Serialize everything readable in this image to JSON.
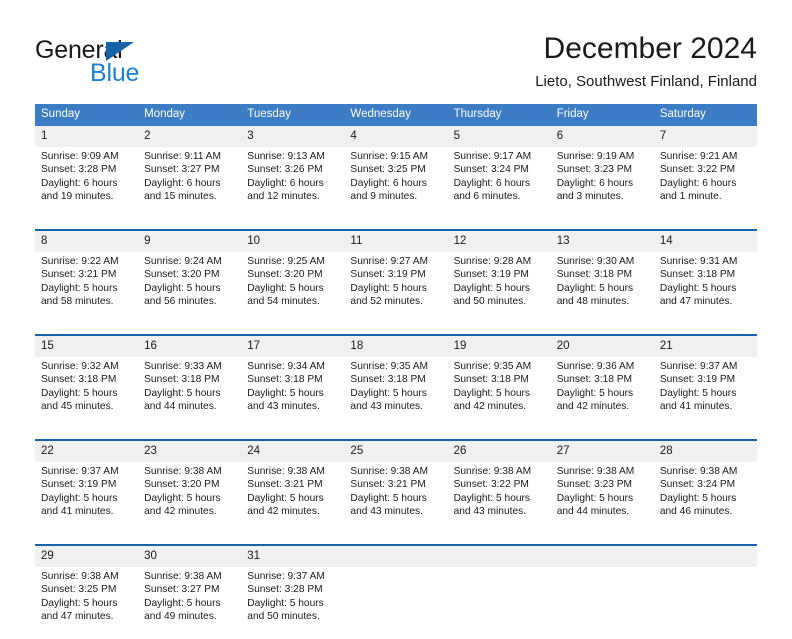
{
  "brand": {
    "name_part1": "General",
    "name_part2": "Blue",
    "triangle_color": "#1763ab",
    "blue_color": "#1b7fd4"
  },
  "header": {
    "title": "December 2024",
    "subtitle": "Lieto, Southwest Finland, Finland"
  },
  "theme": {
    "header_blue": "#3b7cc4",
    "rule_blue": "#1763ab",
    "daynum_band": "#f0f0f0"
  },
  "calendar": {
    "weekday_headers": [
      "Sunday",
      "Monday",
      "Tuesday",
      "Wednesday",
      "Thursday",
      "Friday",
      "Saturday"
    ],
    "weeks": [
      [
        {
          "day": "1",
          "sunrise": "Sunrise: 9:09 AM",
          "sunset": "Sunset: 3:28 PM",
          "daylight": "Daylight: 6 hours and 19 minutes."
        },
        {
          "day": "2",
          "sunrise": "Sunrise: 9:11 AM",
          "sunset": "Sunset: 3:27 PM",
          "daylight": "Daylight: 6 hours and 15 minutes."
        },
        {
          "day": "3",
          "sunrise": "Sunrise: 9:13 AM",
          "sunset": "Sunset: 3:26 PM",
          "daylight": "Daylight: 6 hours and 12 minutes."
        },
        {
          "day": "4",
          "sunrise": "Sunrise: 9:15 AM",
          "sunset": "Sunset: 3:25 PM",
          "daylight": "Daylight: 6 hours and 9 minutes."
        },
        {
          "day": "5",
          "sunrise": "Sunrise: 9:17 AM",
          "sunset": "Sunset: 3:24 PM",
          "daylight": "Daylight: 6 hours and 6 minutes."
        },
        {
          "day": "6",
          "sunrise": "Sunrise: 9:19 AM",
          "sunset": "Sunset: 3:23 PM",
          "daylight": "Daylight: 6 hours and 3 minutes."
        },
        {
          "day": "7",
          "sunrise": "Sunrise: 9:21 AM",
          "sunset": "Sunset: 3:22 PM",
          "daylight": "Daylight: 6 hours and 1 minute."
        }
      ],
      [
        {
          "day": "8",
          "sunrise": "Sunrise: 9:22 AM",
          "sunset": "Sunset: 3:21 PM",
          "daylight": "Daylight: 5 hours and 58 minutes."
        },
        {
          "day": "9",
          "sunrise": "Sunrise: 9:24 AM",
          "sunset": "Sunset: 3:20 PM",
          "daylight": "Daylight: 5 hours and 56 minutes."
        },
        {
          "day": "10",
          "sunrise": "Sunrise: 9:25 AM",
          "sunset": "Sunset: 3:20 PM",
          "daylight": "Daylight: 5 hours and 54 minutes."
        },
        {
          "day": "11",
          "sunrise": "Sunrise: 9:27 AM",
          "sunset": "Sunset: 3:19 PM",
          "daylight": "Daylight: 5 hours and 52 minutes."
        },
        {
          "day": "12",
          "sunrise": "Sunrise: 9:28 AM",
          "sunset": "Sunset: 3:19 PM",
          "daylight": "Daylight: 5 hours and 50 minutes."
        },
        {
          "day": "13",
          "sunrise": "Sunrise: 9:30 AM",
          "sunset": "Sunset: 3:18 PM",
          "daylight": "Daylight: 5 hours and 48 minutes."
        },
        {
          "day": "14",
          "sunrise": "Sunrise: 9:31 AM",
          "sunset": "Sunset: 3:18 PM",
          "daylight": "Daylight: 5 hours and 47 minutes."
        }
      ],
      [
        {
          "day": "15",
          "sunrise": "Sunrise: 9:32 AM",
          "sunset": "Sunset: 3:18 PM",
          "daylight": "Daylight: 5 hours and 45 minutes."
        },
        {
          "day": "16",
          "sunrise": "Sunrise: 9:33 AM",
          "sunset": "Sunset: 3:18 PM",
          "daylight": "Daylight: 5 hours and 44 minutes."
        },
        {
          "day": "17",
          "sunrise": "Sunrise: 9:34 AM",
          "sunset": "Sunset: 3:18 PM",
          "daylight": "Daylight: 5 hours and 43 minutes."
        },
        {
          "day": "18",
          "sunrise": "Sunrise: 9:35 AM",
          "sunset": "Sunset: 3:18 PM",
          "daylight": "Daylight: 5 hours and 43 minutes."
        },
        {
          "day": "19",
          "sunrise": "Sunrise: 9:35 AM",
          "sunset": "Sunset: 3:18 PM",
          "daylight": "Daylight: 5 hours and 42 minutes."
        },
        {
          "day": "20",
          "sunrise": "Sunrise: 9:36 AM",
          "sunset": "Sunset: 3:18 PM",
          "daylight": "Daylight: 5 hours and 42 minutes."
        },
        {
          "day": "21",
          "sunrise": "Sunrise: 9:37 AM",
          "sunset": "Sunset: 3:19 PM",
          "daylight": "Daylight: 5 hours and 41 minutes."
        }
      ],
      [
        {
          "day": "22",
          "sunrise": "Sunrise: 9:37 AM",
          "sunset": "Sunset: 3:19 PM",
          "daylight": "Daylight: 5 hours and 41 minutes."
        },
        {
          "day": "23",
          "sunrise": "Sunrise: 9:38 AM",
          "sunset": "Sunset: 3:20 PM",
          "daylight": "Daylight: 5 hours and 42 minutes."
        },
        {
          "day": "24",
          "sunrise": "Sunrise: 9:38 AM",
          "sunset": "Sunset: 3:21 PM",
          "daylight": "Daylight: 5 hours and 42 minutes."
        },
        {
          "day": "25",
          "sunrise": "Sunrise: 9:38 AM",
          "sunset": "Sunset: 3:21 PM",
          "daylight": "Daylight: 5 hours and 43 minutes."
        },
        {
          "day": "26",
          "sunrise": "Sunrise: 9:38 AM",
          "sunset": "Sunset: 3:22 PM",
          "daylight": "Daylight: 5 hours and 43 minutes."
        },
        {
          "day": "27",
          "sunrise": "Sunrise: 9:38 AM",
          "sunset": "Sunset: 3:23 PM",
          "daylight": "Daylight: 5 hours and 44 minutes."
        },
        {
          "day": "28",
          "sunrise": "Sunrise: 9:38 AM",
          "sunset": "Sunset: 3:24 PM",
          "daylight": "Daylight: 5 hours and 46 minutes."
        }
      ],
      [
        {
          "day": "29",
          "sunrise": "Sunrise: 9:38 AM",
          "sunset": "Sunset: 3:25 PM",
          "daylight": "Daylight: 5 hours and 47 minutes."
        },
        {
          "day": "30",
          "sunrise": "Sunrise: 9:38 AM",
          "sunset": "Sunset: 3:27 PM",
          "daylight": "Daylight: 5 hours and 49 minutes."
        },
        {
          "day": "31",
          "sunrise": "Sunrise: 9:37 AM",
          "sunset": "Sunset: 3:28 PM",
          "daylight": "Daylight: 5 hours and 50 minutes."
        },
        {
          "day": "",
          "sunrise": "",
          "sunset": "",
          "daylight": ""
        },
        {
          "day": "",
          "sunrise": "",
          "sunset": "",
          "daylight": ""
        },
        {
          "day": "",
          "sunrise": "",
          "sunset": "",
          "daylight": ""
        },
        {
          "day": "",
          "sunrise": "",
          "sunset": "",
          "daylight": ""
        }
      ]
    ]
  }
}
